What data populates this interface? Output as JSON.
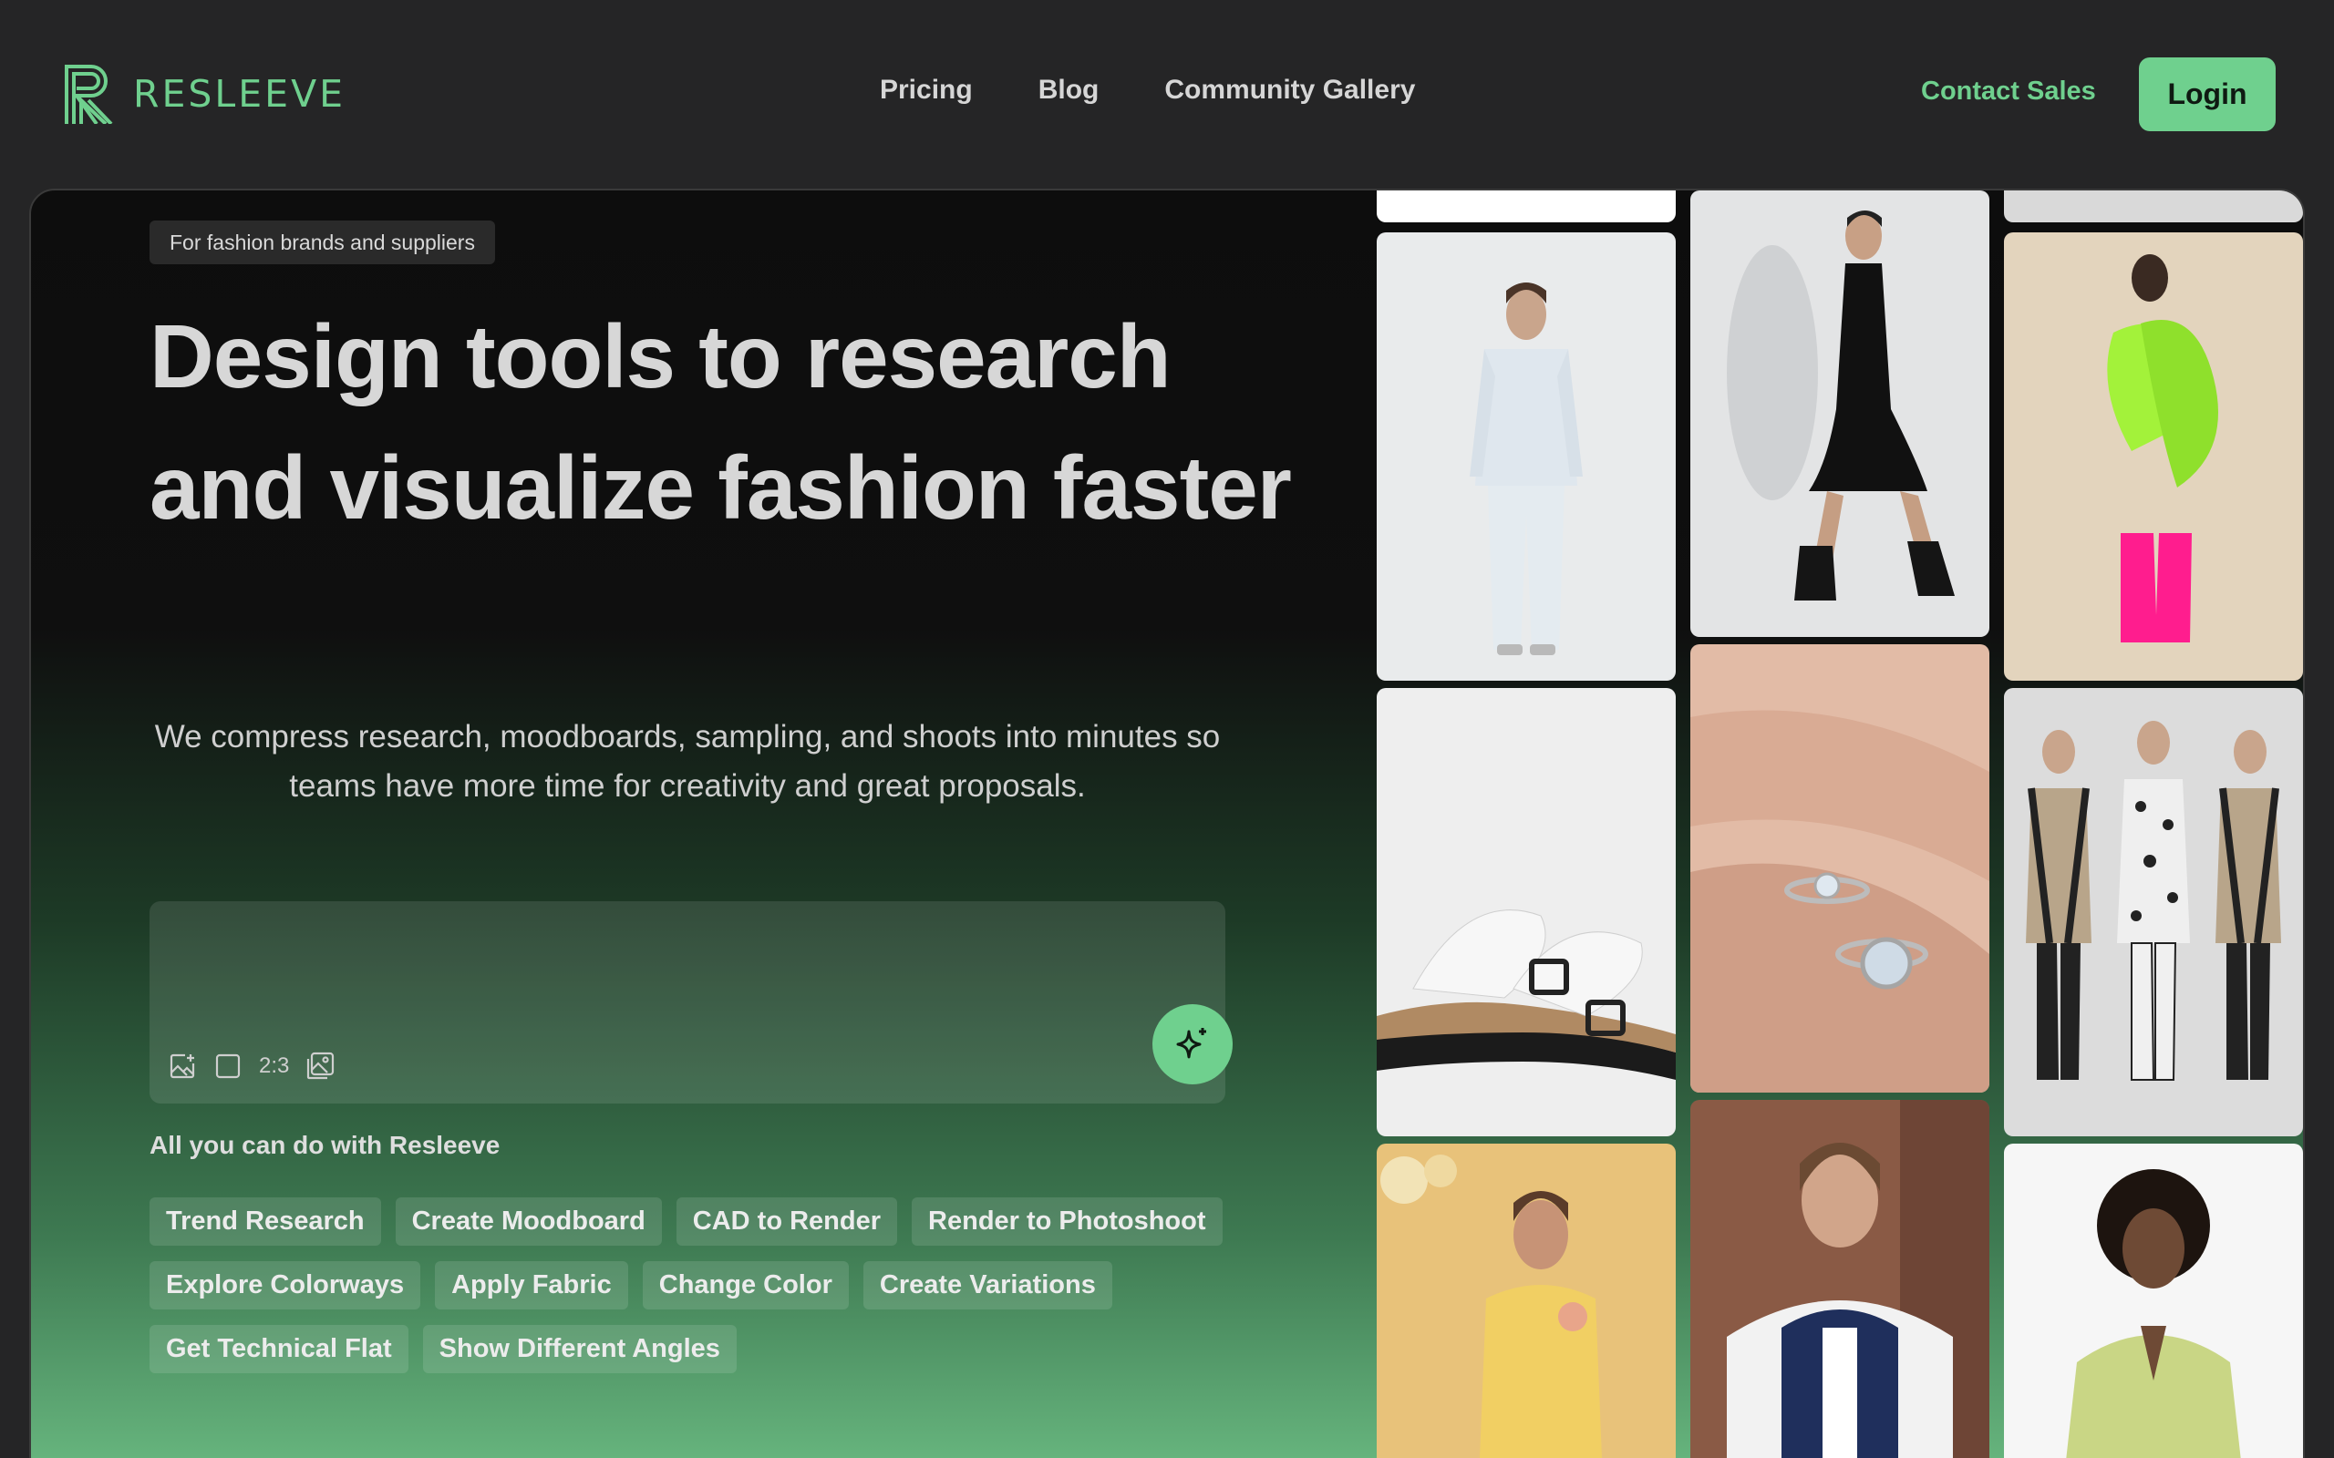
{
  "brand": {
    "name": "RESLEEVE",
    "color": "#6fd08e"
  },
  "nav": {
    "links": [
      "Pricing",
      "Blog",
      "Community Gallery"
    ],
    "contact": "Contact Sales",
    "login": "Login"
  },
  "hero": {
    "badge": "For fashion brands and suppliers",
    "headline": "Design tools to research and visualize fashion faster",
    "subtitle": "We compress research, moodboards, sampling, and shoots into minutes so teams have more time for creativity and great proposals.",
    "prompt": {
      "placeholder": "",
      "ratio": "2:3",
      "icons": [
        "add-image-icon",
        "frame-icon",
        "gallery-icon",
        "sparkle-icon"
      ]
    },
    "section_label": "All you can do with Resleeve",
    "chips": [
      [
        "Trend Research",
        "Create Moodboard",
        "CAD to Render",
        "Render to Photoshoot"
      ],
      [
        "Explore Colorways",
        "Apply Fabric",
        "Change Color",
        "Create Variations"
      ],
      [
        "Get Technical Flat",
        "Show Different Angles"
      ]
    ]
  },
  "gallery": {
    "images": [
      "white-pajama-outfit",
      "black-dress-walking",
      "neon-ruffle-dress",
      "white-buckle-sandal",
      "silver-rings-hand",
      "patterned-knit-trio",
      "yellow-blouse",
      "varsity-jacket",
      "green-cardigan"
    ]
  }
}
